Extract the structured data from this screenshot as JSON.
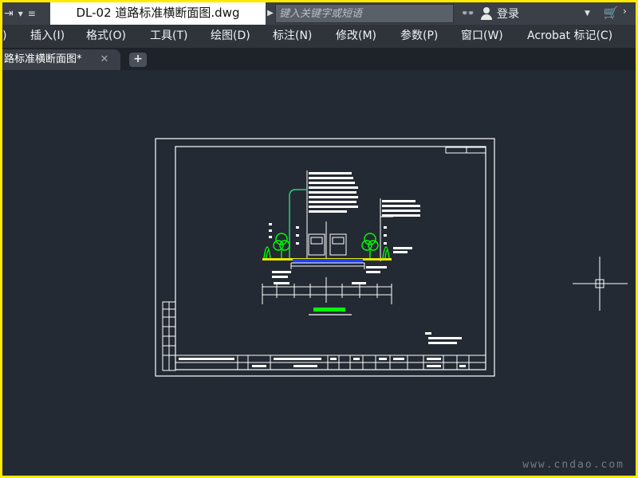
{
  "titlebar": {
    "document_title": "DL-02 道路标准横断面图.dwg",
    "search_placeholder": "键入关键字或短语",
    "login_label": "登录"
  },
  "menu": {
    "items": [
      "插入(I)",
      "格式(O)",
      "工具(T)",
      "绘图(D)",
      "标注(N)",
      "修改(M)",
      "参数(P)",
      "窗口(W)",
      "Acrobat 标记(C)"
    ],
    "partial_left": ")"
  },
  "tabs": {
    "active_tab": "路标准横断面图*",
    "close_glyph": "✕",
    "new_tab_glyph": "+"
  },
  "watermark": {
    "site": "www.cndao.com"
  },
  "colors": {
    "outer_border": "#ffea00",
    "canvas": "#232a33",
    "linework": "#ffffff",
    "tree_green": "#00ff00",
    "road_blue": "#1e3cff",
    "curb_yellow": "#e6e600"
  }
}
